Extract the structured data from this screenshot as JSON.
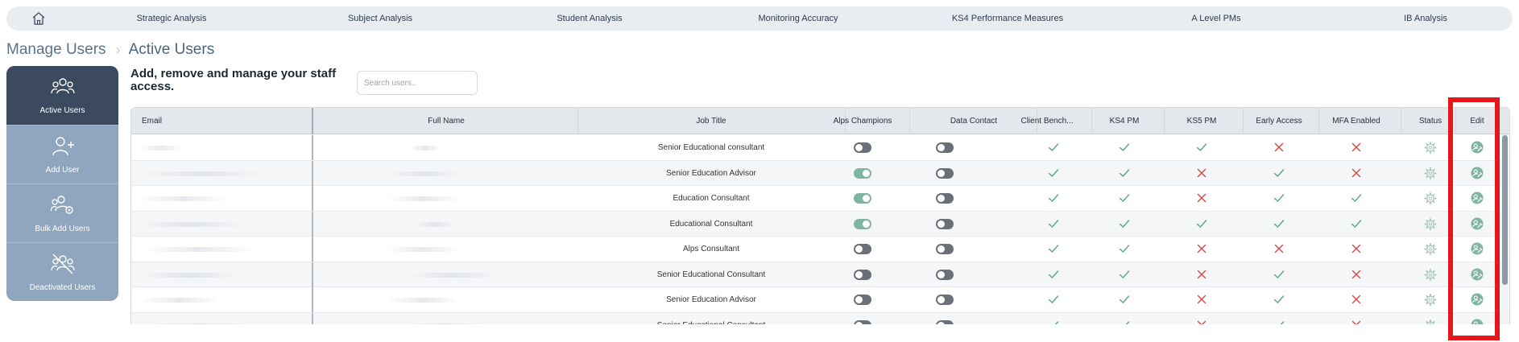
{
  "topnav": {
    "home_icon": "home-icon",
    "items": [
      {
        "label": "Strategic Analysis"
      },
      {
        "label": "Subject Analysis"
      },
      {
        "label": "Student Analysis"
      },
      {
        "label": "Monitoring Accuracy"
      },
      {
        "label": "KS4 Performance Measures"
      },
      {
        "label": "A Level PMs"
      },
      {
        "label": "IB Analysis"
      }
    ]
  },
  "breadcrumb": {
    "parent": "Manage Users",
    "separator": "chevron-right-icon",
    "current": "Active Users"
  },
  "sidebar": {
    "items": [
      {
        "label": "Active Users",
        "icon": "users-icon",
        "active": true
      },
      {
        "label": "Add User",
        "icon": "user-plus-icon",
        "active": false
      },
      {
        "label": "Bulk Add Users",
        "icon": "users-gear-icon",
        "active": false
      },
      {
        "label": "Deactivated Users",
        "icon": "users-slash-icon",
        "active": false
      }
    ]
  },
  "main": {
    "description": "Add, remove and manage your staff access.",
    "search_placeholder": "Search users.."
  },
  "table": {
    "headers": {
      "email": "Email",
      "full_name": "Full Name",
      "job_title": "Job Title",
      "alps_champions": "Alps Champions",
      "data_contact": "Data Contact",
      "client_bench": "Client Bench...",
      "ks4_pm": "KS4 PM",
      "ks5_pm": "KS5 PM",
      "early_access": "Early Access",
      "mfa_enabled": "MFA Enabled",
      "status": "Status",
      "edit": "Edit"
    },
    "rows": [
      {
        "job_title": "Senior Educational consultant",
        "alps_champion": false,
        "data_contact": false,
        "client_bench": true,
        "ks4_pm": true,
        "ks5_pm": true,
        "early_access": false,
        "mfa_enabled": false
      },
      {
        "job_title": "Senior Education Advisor",
        "alps_champion": true,
        "data_contact": false,
        "client_bench": true,
        "ks4_pm": true,
        "ks5_pm": false,
        "early_access": true,
        "mfa_enabled": false
      },
      {
        "job_title": "Education Consultant",
        "alps_champion": true,
        "data_contact": false,
        "client_bench": true,
        "ks4_pm": true,
        "ks5_pm": false,
        "early_access": true,
        "mfa_enabled": true
      },
      {
        "job_title": "Educational Consultant",
        "alps_champion": true,
        "data_contact": false,
        "client_bench": true,
        "ks4_pm": true,
        "ks5_pm": true,
        "early_access": true,
        "mfa_enabled": true
      },
      {
        "job_title": "Alps Consultant",
        "alps_champion": false,
        "data_contact": false,
        "client_bench": true,
        "ks4_pm": true,
        "ks5_pm": false,
        "early_access": false,
        "mfa_enabled": false
      },
      {
        "job_title": "Senior Educational Consultant",
        "alps_champion": false,
        "data_contact": false,
        "client_bench": true,
        "ks4_pm": true,
        "ks5_pm": false,
        "early_access": true,
        "mfa_enabled": false
      },
      {
        "job_title": "Senior Education Advisor",
        "alps_champion": false,
        "data_contact": false,
        "client_bench": true,
        "ks4_pm": true,
        "ks5_pm": false,
        "early_access": true,
        "mfa_enabled": false
      },
      {
        "job_title": "Senior Educational Consultant",
        "alps_champion": false,
        "data_contact": false,
        "client_bench": true,
        "ks4_pm": true,
        "ks5_pm": false,
        "early_access": true,
        "mfa_enabled": false
      }
    ],
    "icons": {
      "yes": "check-icon",
      "no": "cross-icon",
      "status": "gear-icon",
      "edit": "edit-user-icon"
    }
  },
  "colors": {
    "check": "#5aa87a",
    "cross": "#d64545",
    "toggle_on": "#7fb4a0",
    "toggle_off": "#6b7078",
    "sidebar_active": "#3b4a5e",
    "sidebar_bg": "#8fa6be",
    "highlight": "#e4181b",
    "edit_icon": "#7fb4a0",
    "status_icon": "#a8c8b8"
  }
}
